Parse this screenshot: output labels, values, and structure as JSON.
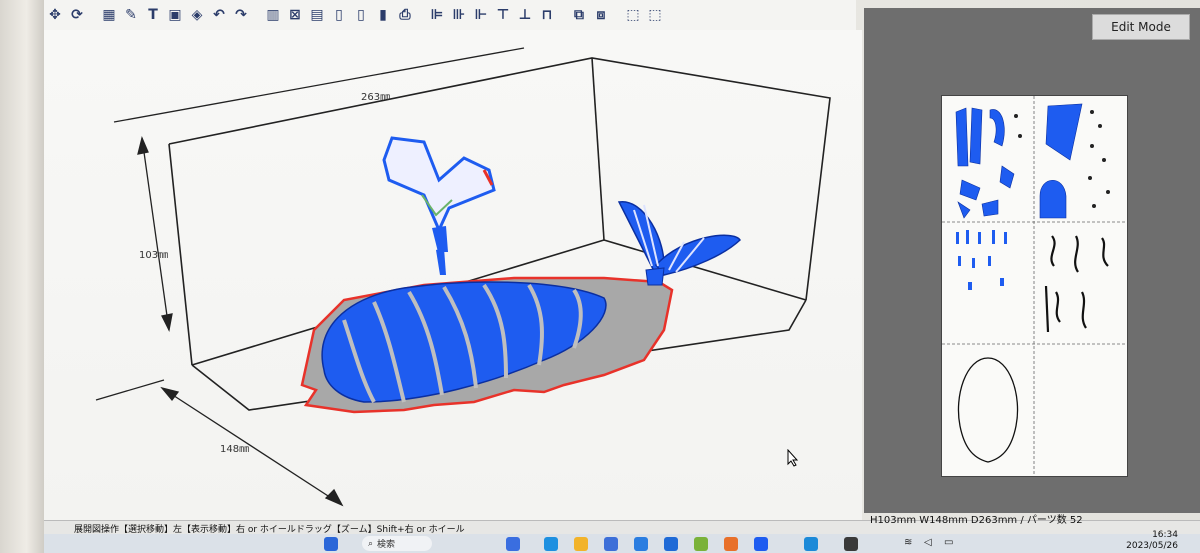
{
  "toolbar": {
    "buttons": [
      "select-icon",
      "rotate-icon",
      "grid-icon",
      "pen-icon",
      "text-icon",
      "image-icon",
      "cube-icon",
      "undo-icon",
      "redo-icon",
      "book-icon",
      "fit-icon",
      "layout-icon",
      "page-icon",
      "page2-icon",
      "clipboard-icon",
      "print-icon",
      "align-left-icon",
      "align-center-icon",
      "align-right-icon",
      "align-top-icon",
      "align-middle-icon",
      "align-bottom-icon",
      "flip-icon",
      "mirror-icon",
      "frame-icon",
      "dashed-frame-icon"
    ],
    "text_button_glyph": "T"
  },
  "viewport": {
    "dimensions": {
      "depth": "263㎜",
      "height": "103㎜",
      "width": "148㎜"
    }
  },
  "right_panel": {
    "mode_tab": "Edit Mode"
  },
  "status": {
    "left": "展開図操作【選択移動】左【表示移動】右 or ホイールドラッグ【ズーム】Shift+右 or ホイール",
    "right": "H103mm W148mm D263mm / パーツ数 52"
  },
  "taskbar": {
    "search_label": "検索",
    "time": "16:34",
    "date": "2023/05/26"
  },
  "colors": {
    "accent_blue": "#1e5cf0",
    "outline_red": "#e8322a",
    "base_gray": "#a9a9a9",
    "panel_gray": "#6e6e6e"
  }
}
